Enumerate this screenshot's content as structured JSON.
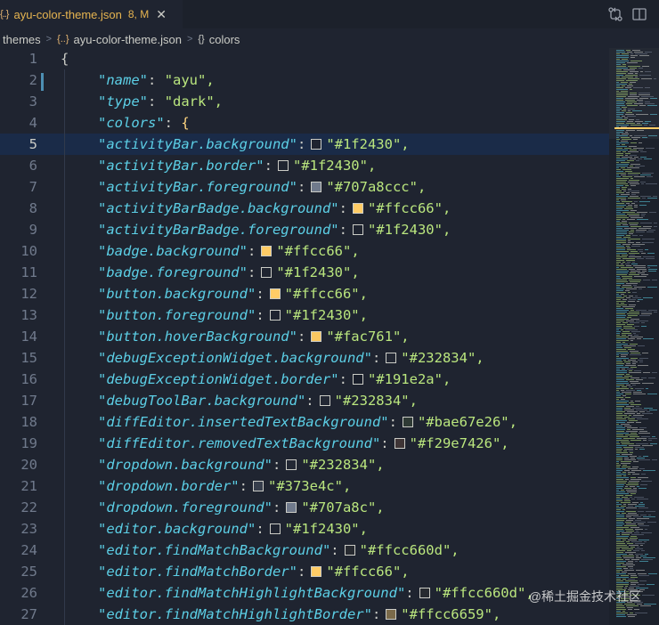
{
  "tab": {
    "icon": "{..}",
    "filename": "ayu-color-theme.json",
    "status": "8, M",
    "close": "✕"
  },
  "toolbar": {
    "compare_icon": "git-compare-icon",
    "split_icon": "split-editor-icon"
  },
  "breadcrumb": {
    "items": [
      "themes",
      "ayu-color-theme.json",
      "colors"
    ],
    "json_icon": "{..}",
    "obj_icon": "{}"
  },
  "colors": {
    "background": "#1f2430",
    "key": "#5ccfe6",
    "string": "#bae67e",
    "line_number": "#707a8c",
    "current_line": "#1a2b48",
    "accent": "#ffcc66"
  },
  "lines": [
    {
      "n": "1",
      "text": "{"
    },
    {
      "n": "2",
      "key": "\"name\"",
      "value": "\"ayu\","
    },
    {
      "n": "3",
      "key": "\"type\"",
      "value": "\"dark\","
    },
    {
      "n": "4",
      "key": "\"colors\"",
      "value": "{"
    },
    {
      "n": "5",
      "key": "\"activityBar.background\"",
      "value": "\"#1f2430\",",
      "swatch": "#1f2430"
    },
    {
      "n": "6",
      "key": "\"activityBar.border\"",
      "value": "\"#1f2430\",",
      "swatch": "#1f2430"
    },
    {
      "n": "7",
      "key": "\"activityBar.foreground\"",
      "value": "\"#707a8ccc\",",
      "swatch": "#707a8c"
    },
    {
      "n": "8",
      "key": "\"activityBarBadge.background\"",
      "value": "\"#ffcc66\",",
      "swatch": "#ffcc66"
    },
    {
      "n": "9",
      "key": "\"activityBarBadge.foreground\"",
      "value": "\"#1f2430\",",
      "swatch": "#1f2430"
    },
    {
      "n": "10",
      "key": "\"badge.background\"",
      "value": "\"#ffcc66\",",
      "swatch": "#ffcc66"
    },
    {
      "n": "11",
      "key": "\"badge.foreground\"",
      "value": "\"#1f2430\",",
      "swatch": "#1f2430"
    },
    {
      "n": "12",
      "key": "\"button.background\"",
      "value": "\"#ffcc66\",",
      "swatch": "#ffcc66"
    },
    {
      "n": "13",
      "key": "\"button.foreground\"",
      "value": "\"#1f2430\",",
      "swatch": "#1f2430"
    },
    {
      "n": "14",
      "key": "\"button.hoverBackground\"",
      "value": "\"#fac761\",",
      "swatch": "#fac761"
    },
    {
      "n": "15",
      "key": "\"debugExceptionWidget.background\"",
      "value": "\"#232834\",",
      "swatch": "#232834"
    },
    {
      "n": "16",
      "key": "\"debugExceptionWidget.border\"",
      "value": "\"#191e2a\",",
      "swatch": "#191e2a"
    },
    {
      "n": "17",
      "key": "\"debugToolBar.background\"",
      "value": "\"#232834\",",
      "swatch": "#232834"
    },
    {
      "n": "18",
      "key": "\"diffEditor.insertedTextBackground\"",
      "value": "\"#bae67e26\",",
      "swatch": "#2f3a35"
    },
    {
      "n": "19",
      "key": "\"diffEditor.removedTextBackground\"",
      "value": "\"#f29e7426\",",
      "swatch": "#3f3536"
    },
    {
      "n": "20",
      "key": "\"dropdown.background\"",
      "value": "\"#232834\",",
      "swatch": "#232834"
    },
    {
      "n": "21",
      "key": "\"dropdown.border\"",
      "value": "\"#373e4c\",",
      "swatch": "#373e4c"
    },
    {
      "n": "22",
      "key": "\"dropdown.foreground\"",
      "value": "\"#707a8c\",",
      "swatch": "#707a8c"
    },
    {
      "n": "23",
      "key": "\"editor.background\"",
      "value": "\"#1f2430\",",
      "swatch": "#1f2430"
    },
    {
      "n": "24",
      "key": "\"editor.findMatchBackground\"",
      "value": "\"#ffcc660d\",",
      "swatch": "#272a30"
    },
    {
      "n": "25",
      "key": "\"editor.findMatchBorder\"",
      "value": "\"#ffcc66\",",
      "swatch": "#ffcc66"
    },
    {
      "n": "26",
      "key": "\"editor.findMatchHighlightBackground\"",
      "value": "\"#ffcc660d\",",
      "swatch": "#272a30"
    },
    {
      "n": "27",
      "key": "\"editor.findMatchHighlightBorder\"",
      "value": "\"#ffcc6659\",",
      "swatch": "#7a6a4a"
    }
  ],
  "current_line": "5",
  "watermark": "@稀土掘金技术社区"
}
